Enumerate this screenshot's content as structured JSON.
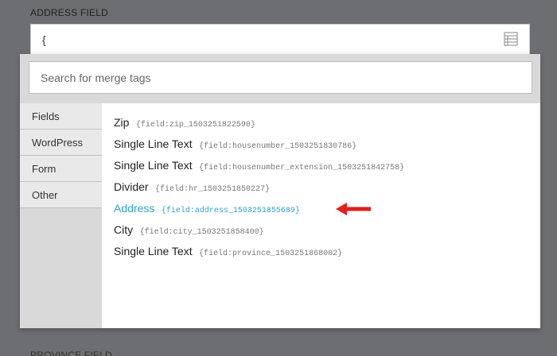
{
  "address_field": {
    "label": "ADDRESS FIELD",
    "value": "{",
    "icon": "list-icon"
  },
  "next_field_label": "PROVINCE FIELD",
  "merge_tags": {
    "search": {
      "placeholder": "Search for merge tags"
    },
    "sidebar": {
      "items": [
        {
          "label": "Fields"
        },
        {
          "label": "WordPress"
        },
        {
          "label": "Form"
        },
        {
          "label": "Other"
        }
      ]
    },
    "items": [
      {
        "label": "Zip",
        "tag": "{field:zip_1503251822590}"
      },
      {
        "label": "Single Line Text",
        "tag": "{field:housenumber_1503251830786}"
      },
      {
        "label": "Single Line Text",
        "tag": "{field:housenumber_extension_1503251842758}"
      },
      {
        "label": "Divider",
        "tag": "{field:hr_1503251850227}"
      },
      {
        "label": "Address",
        "tag": "{field:address_1503251855689}"
      },
      {
        "label": "City",
        "tag": "{field:city_1503251858400}"
      },
      {
        "label": "Single Line Text",
        "tag": "{field:province_1503251868002}"
      }
    ],
    "highlighted_index": 4
  },
  "colors": {
    "overlay": "#6d6e71",
    "highlight": "#2ea2cc",
    "annotation_arrow": "#e0211d"
  }
}
